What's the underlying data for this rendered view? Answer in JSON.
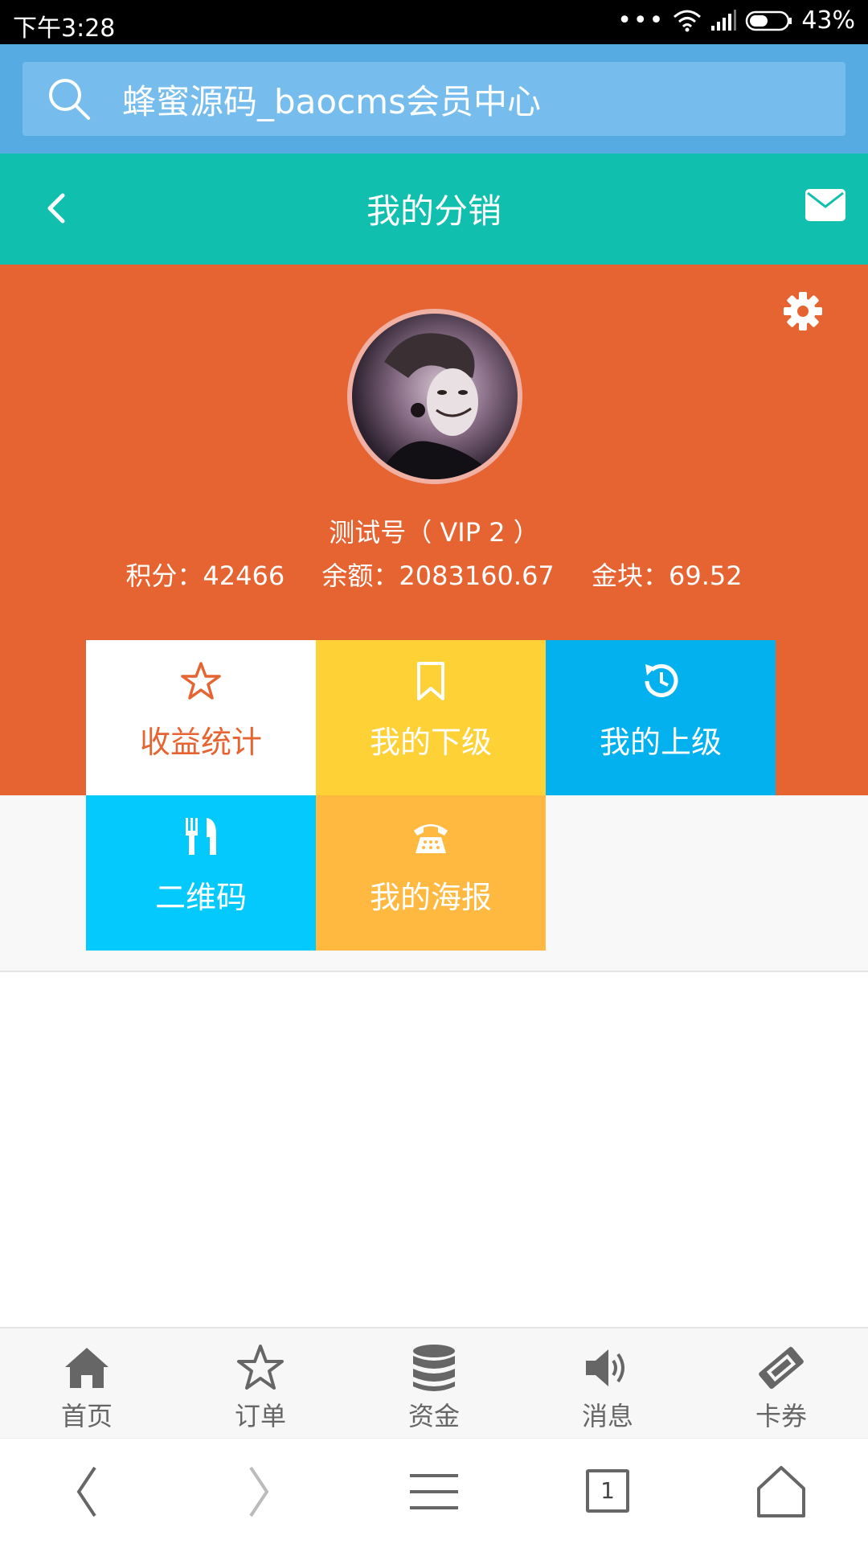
{
  "status_bar": {
    "time": "下午3:28",
    "battery": "43%"
  },
  "search": {
    "text": "蜂蜜源码_baocms会员中心"
  },
  "header": {
    "title": "我的分销"
  },
  "profile": {
    "name": "测试号（ VIP 2 ）",
    "points": "积分：42466",
    "balance": "余额：2083160.67",
    "gold": "金块：69.52"
  },
  "tiles": [
    {
      "label": "收益统计",
      "icon": "star-outline-icon",
      "bg": "#ffffff",
      "fg": "#e66332"
    },
    {
      "label": "我的下级",
      "icon": "bookmark-icon",
      "bg": "#fed136",
      "fg": "#ffffff"
    },
    {
      "label": "我的上级",
      "icon": "history-icon",
      "bg": "#04b1ef",
      "fg": "#ffffff"
    },
    {
      "label": "二维码",
      "icon": "cutlery-icon",
      "bg": "#04c9fd",
      "fg": "#ffffff"
    },
    {
      "label": "我的海报",
      "icon": "phone-icon",
      "bg": "#ffb940",
      "fg": "#ffffff"
    }
  ],
  "tabbar": [
    {
      "label": "首页",
      "icon": "home-icon"
    },
    {
      "label": "订单",
      "icon": "star-icon"
    },
    {
      "label": "资金",
      "icon": "database-icon"
    },
    {
      "label": "消息",
      "icon": "volume-icon"
    },
    {
      "label": "卡券",
      "icon": "ticket-icon"
    }
  ],
  "browser_nav": {
    "tab_count": "1"
  },
  "colors": {
    "hero": "#e66332",
    "titlebar": "#10bfad",
    "searchbar": "#56abe3"
  }
}
